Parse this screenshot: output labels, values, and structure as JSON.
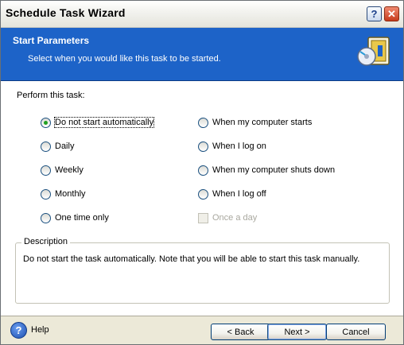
{
  "window": {
    "title": "Schedule Task Wizard",
    "help_glyph": "?",
    "close_glyph": "✕"
  },
  "header": {
    "title": "Start Parameters",
    "subtitle": "Select when you would like this task to be started."
  },
  "perform": {
    "label": "Perform this task:",
    "left_options": [
      {
        "label": "Do not start automatically",
        "checked": true
      },
      {
        "label": "Daily",
        "checked": false
      },
      {
        "label": "Weekly",
        "checked": false
      },
      {
        "label": "Monthly",
        "checked": false
      },
      {
        "label": "One time only",
        "checked": false
      }
    ],
    "right_options": [
      {
        "label": "When my computer starts",
        "checked": false
      },
      {
        "label": "When I log on",
        "checked": false
      },
      {
        "label": "When my computer shuts down",
        "checked": false
      },
      {
        "label": "When I log off",
        "checked": false
      }
    ],
    "once_a_day": {
      "label": "Once a day",
      "checked": false,
      "enabled": false
    }
  },
  "description": {
    "label": "Description",
    "text": "Do not start the task automatically. Note that you will be able to start this task manually."
  },
  "footer": {
    "help_glyph": "?",
    "help_label": "Help",
    "back_label": "< Back",
    "next_label": "Next >",
    "cancel_label": "Cancel"
  },
  "colors": {
    "header_bg": "#1d63c8",
    "radio_check": "#21a121",
    "close_button": "#c63b1c"
  },
  "icons": {
    "wizard": "schedule-wizard-icon",
    "help": "help-icon",
    "close": "close-icon"
  }
}
